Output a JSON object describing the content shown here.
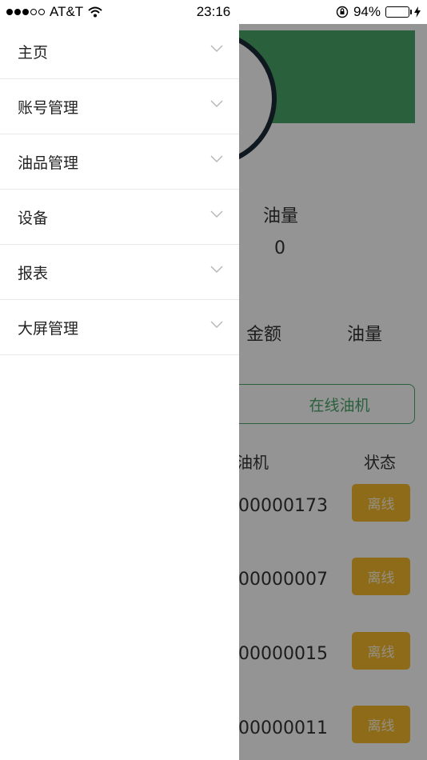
{
  "status_bar": {
    "carrier": "AT&T",
    "time": "23:16",
    "battery_percent": "94%",
    "battery_level": 0.94
  },
  "drawer": {
    "items": [
      {
        "label": "主页"
      },
      {
        "label": "账号管理"
      },
      {
        "label": "油品管理"
      },
      {
        "label": "设备"
      },
      {
        "label": "报表"
      },
      {
        "label": "大屏管理"
      }
    ]
  },
  "background": {
    "oil_volume_label": "油量",
    "oil_volume_value": "0",
    "amount_label": "金额",
    "volume_label": "油量",
    "online_button": "在线油机",
    "table": {
      "col_machine": "油机",
      "col_status": "状态",
      "rows": [
        {
          "machine": "00000173",
          "status": "离线"
        },
        {
          "machine": "00000007",
          "status": "离线"
        },
        {
          "machine": "00000015",
          "status": "离线"
        },
        {
          "machine": "00000011",
          "status": "离线"
        }
      ]
    }
  },
  "colors": {
    "header_green": "#4aa56a",
    "badge_orange": "#f5b82a",
    "battery_green": "#4cd964"
  }
}
